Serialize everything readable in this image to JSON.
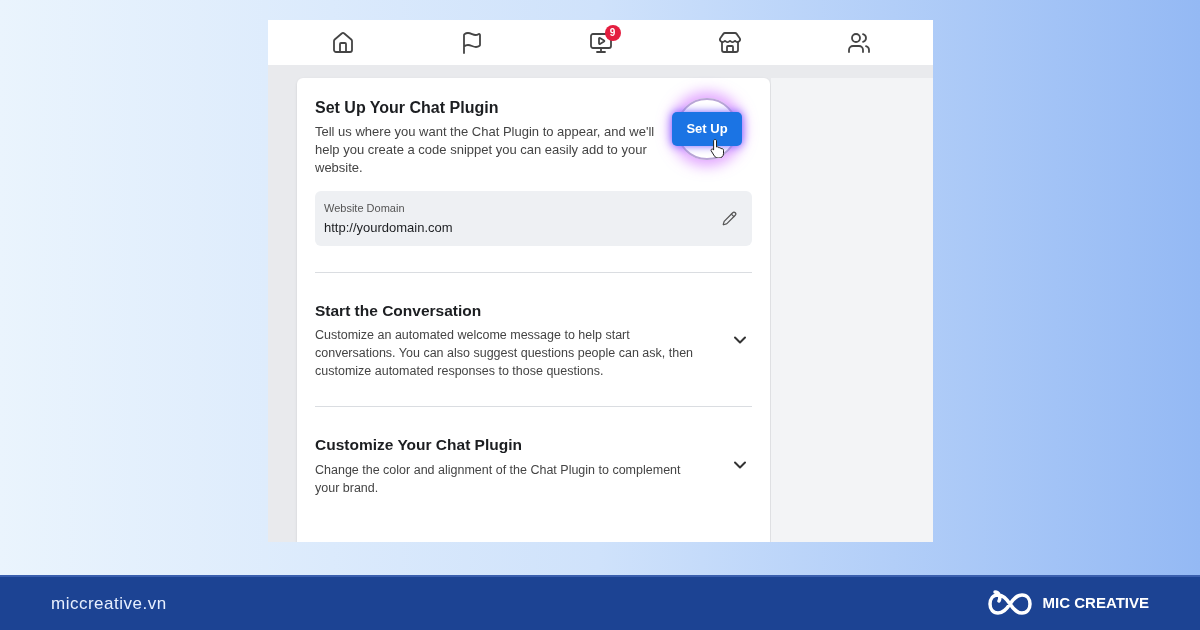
{
  "nav": {
    "icons": [
      {
        "kind": "home"
      },
      {
        "kind": "flag"
      },
      {
        "kind": "video",
        "badge": "9"
      },
      {
        "kind": "store"
      },
      {
        "kind": "groups"
      }
    ]
  },
  "setup": {
    "title": "Set Up Your Chat Plugin",
    "description": "Tell us where you want the Chat Plugin to appear, and we'll help you create a code snippet you can easily add to your website.",
    "button": "Set Up",
    "field": {
      "label": "Website Domain",
      "value": "http://yourdomain.com"
    }
  },
  "sections": [
    {
      "title": "Start the Conversation",
      "description": "Customize an automated welcome message to help start conversations. You can also suggest questions people can ask, then customize automated responses to those questions.",
      "expanded": false
    },
    {
      "title": "Customize Your Chat Plugin",
      "description": "Change the color and alignment of the Chat Plugin to complement your brand.",
      "expanded": false
    }
  ],
  "footer": {
    "site": "miccreative.vn",
    "brand": "MIC CREATIVE"
  }
}
